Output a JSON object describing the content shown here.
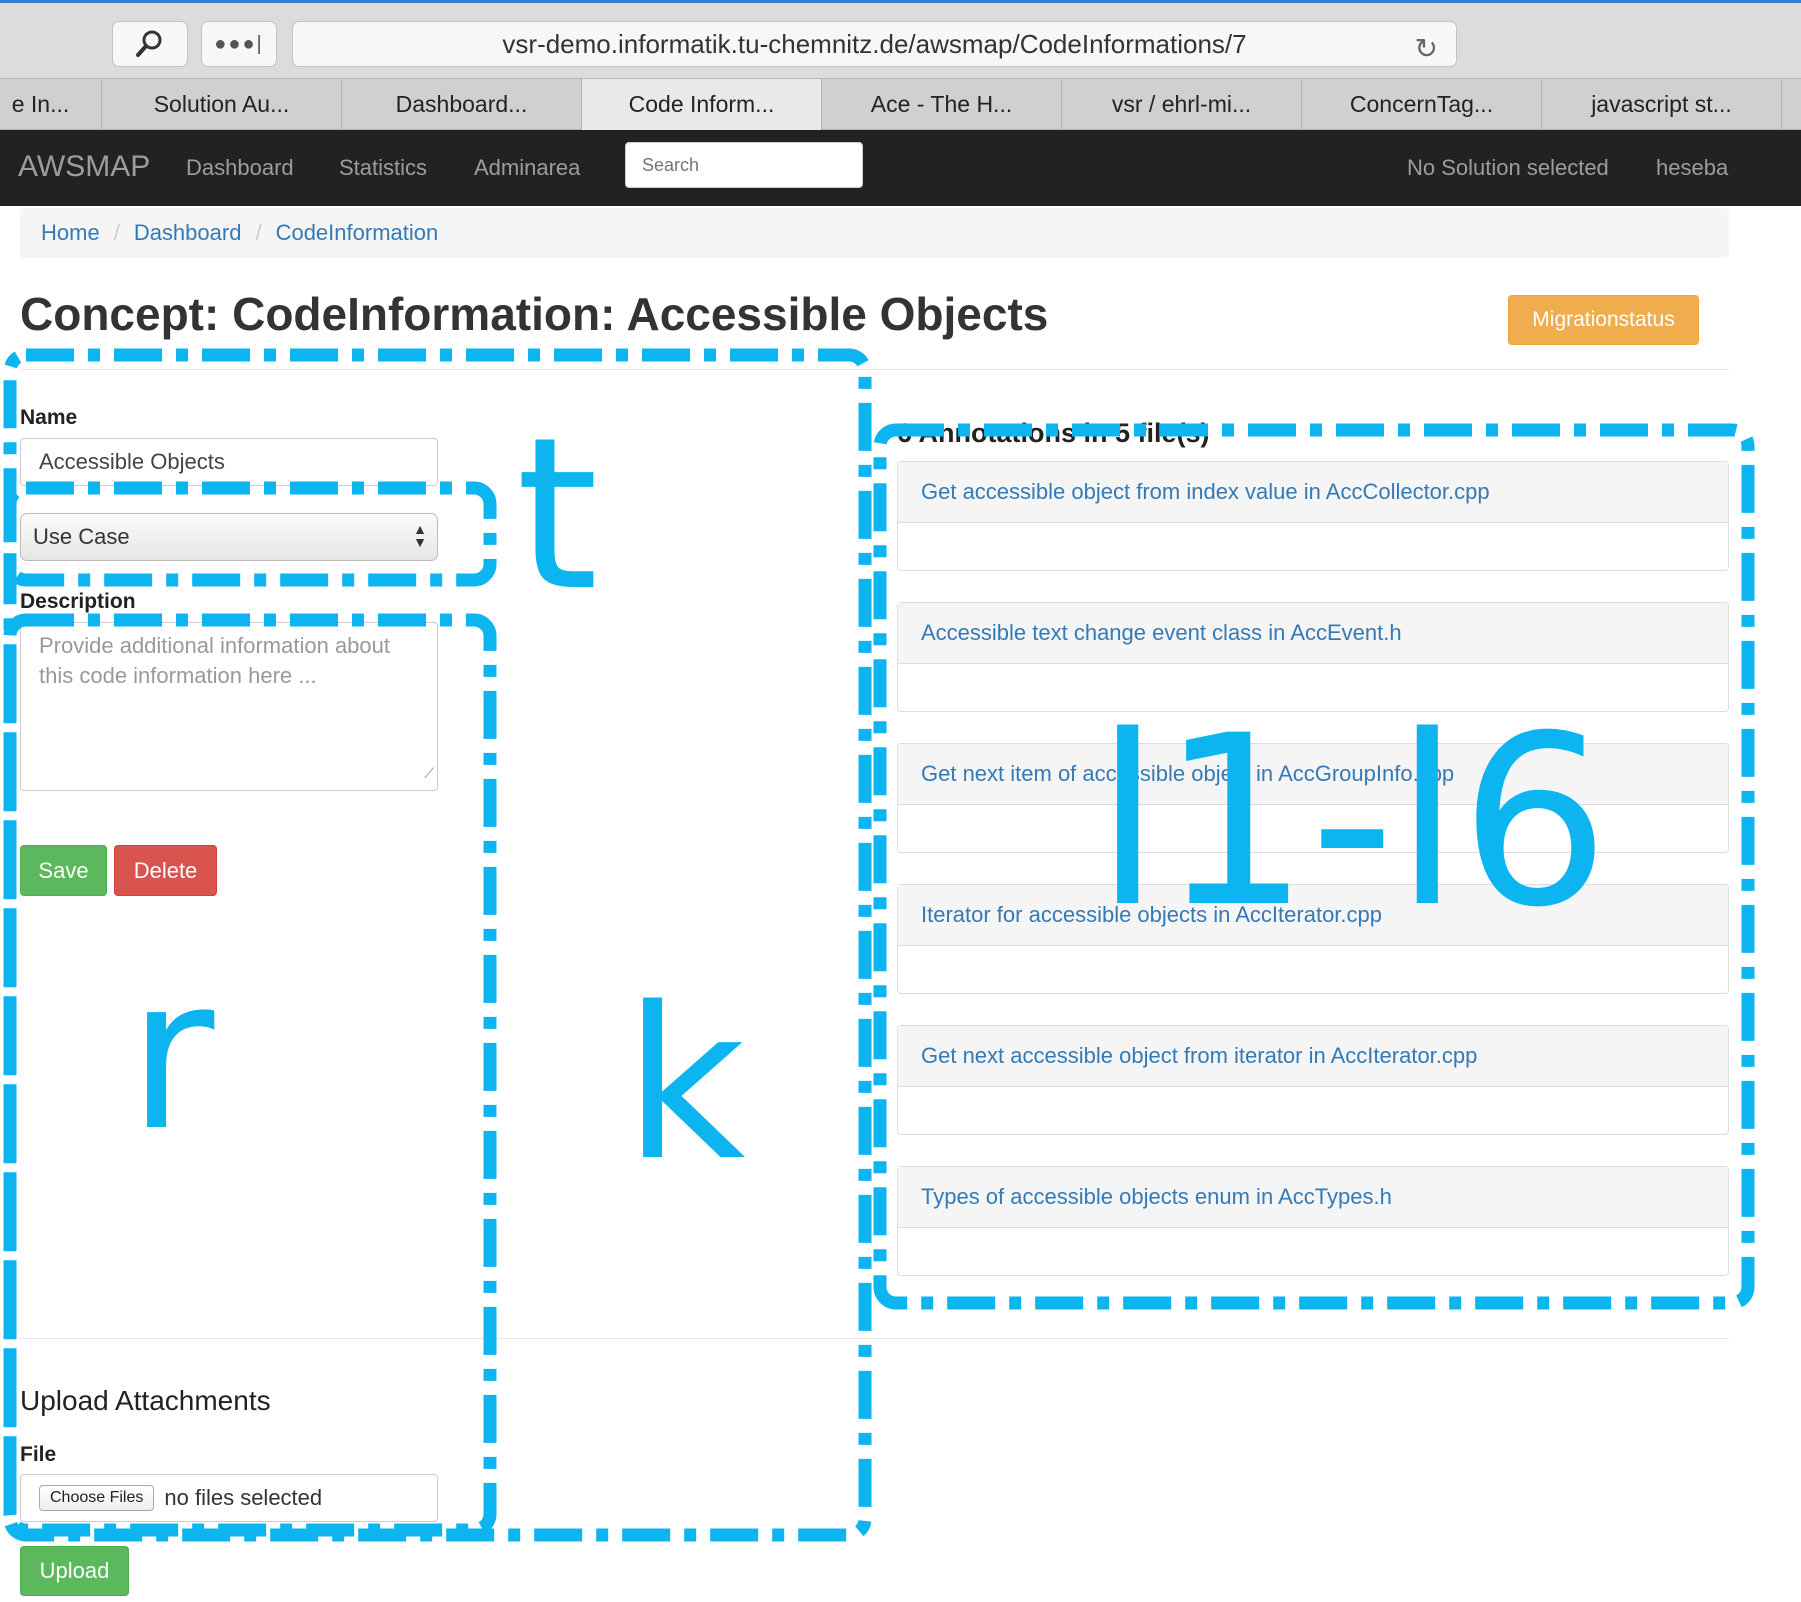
{
  "browser": {
    "url": "vsr-demo.informatik.tu-chemnitz.de/awsmap/CodeInformations/7",
    "tabs": [
      {
        "label": "e In..."
      },
      {
        "label": "Solution Au..."
      },
      {
        "label": "Dashboard..."
      },
      {
        "label": "Code Inform..."
      },
      {
        "label": "Ace - The H..."
      },
      {
        "label": "vsr / ehrl-mi..."
      },
      {
        "label": "ConcernTag..."
      },
      {
        "label": "javascript st..."
      }
    ]
  },
  "navbar": {
    "brand": "AWSMAP",
    "links": [
      "Dashboard",
      "Statistics",
      "Adminarea"
    ],
    "search_placeholder": "Search",
    "solution_status": "No Solution selected",
    "user": "heseba"
  },
  "breadcrumb": [
    "Home",
    "Dashboard",
    "CodeInformation"
  ],
  "page": {
    "title": "Concept: CodeInformation: Accessible Objects",
    "migration_button": "Migrationstatus"
  },
  "form": {
    "name_label": "Name",
    "name_value": "Accessible Objects",
    "type_value": "Use Case",
    "description_label": "Description",
    "description_placeholder": "Provide additional information about this code information here ...",
    "save_label": "Save",
    "delete_label": "Delete"
  },
  "upload": {
    "title": "Upload Attachments",
    "file_label": "File",
    "choose_files_label": "Choose Files",
    "no_files_text": "no files selected",
    "upload_label": "Upload"
  },
  "annotations": {
    "heading": "6 Annotations in 5 file(s)",
    "items": [
      {
        "label": "Get accessible object from index value in AccCollector.cpp"
      },
      {
        "label": "Accessible text change event class in AccEvent.h"
      },
      {
        "label": "Get next item of accessible object in AccGroupInfo.cpp"
      },
      {
        "label": "Iterator for accessible objects in AccIterator.cpp"
      },
      {
        "label": "Get next accessible object from iterator in AccIterator.cpp"
      },
      {
        "label": "Types of accessible objects enum in AccTypes.h"
      }
    ]
  },
  "overlay": {
    "color": "#0cb4f0",
    "labels": {
      "t": "t",
      "r": "r",
      "k": "k",
      "l": "l1-l6"
    }
  }
}
